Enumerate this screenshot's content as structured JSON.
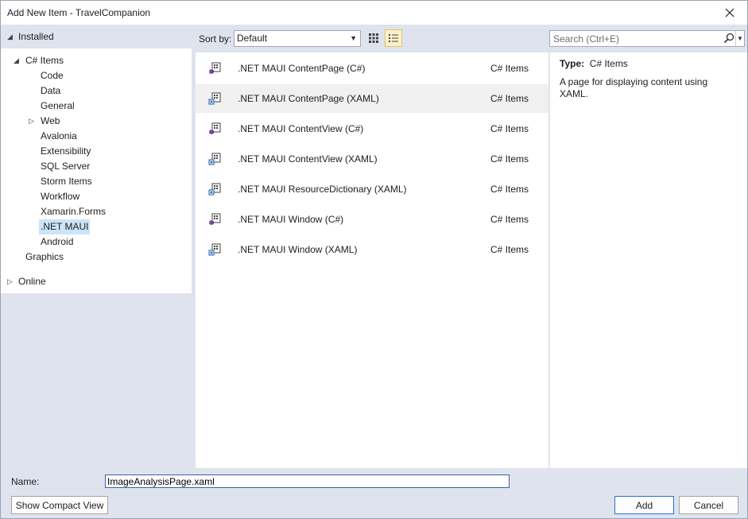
{
  "window": {
    "title": "Add New Item - TravelCompanion"
  },
  "left": {
    "installed": "Installed",
    "tree": {
      "root": "C# Items",
      "children": [
        "Code",
        "Data",
        "General",
        "Web",
        "Avalonia",
        "Extensibility",
        "SQL Server",
        "Storm Items",
        "Workflow",
        "Xamarin.Forms",
        ".NET MAUI",
        "Android"
      ],
      "graphics": "Graphics"
    },
    "selected": ".NET MAUI",
    "online": "Online"
  },
  "toolbar": {
    "sort_label": "Sort by:",
    "sort_value": "Default",
    "search_placeholder": "Search (Ctrl+E)"
  },
  "templates": [
    {
      "name": ".NET MAUI ContentPage (C#)",
      "category": "C# Items",
      "icon": "csharp-page-icon"
    },
    {
      "name": ".NET MAUI ContentPage (XAML)",
      "category": "C# Items",
      "icon": "xaml-page-icon"
    },
    {
      "name": ".NET MAUI ContentView (C#)",
      "category": "C# Items",
      "icon": "csharp-page-icon"
    },
    {
      "name": ".NET MAUI ContentView (XAML)",
      "category": "C# Items",
      "icon": "xaml-page-icon"
    },
    {
      "name": ".NET MAUI ResourceDictionary (XAML)",
      "category": "C# Items",
      "icon": "xaml-page-icon"
    },
    {
      "name": ".NET MAUI Window (C#)",
      "category": "C# Items",
      "icon": "csharp-page-icon"
    },
    {
      "name": ".NET MAUI Window (XAML)",
      "category": "C# Items",
      "icon": "xaml-page-icon"
    }
  ],
  "selected_template": ".NET MAUI ContentPage (XAML)",
  "details": {
    "type_label": "Type:",
    "type_value": "C# Items",
    "description": "A page for displaying content using XAML."
  },
  "footer": {
    "name_label": "Name:",
    "name_value": "ImageAnalysisPage.xaml",
    "compact_button": "Show Compact View",
    "add_button": "Add",
    "cancel_button": "Cancel"
  },
  "colors": {
    "background": "#dfe3ee",
    "selection_highlight": "#cce4f7",
    "active_view_button": "#fcf0c8",
    "primary_button_border": "#2a73cc"
  }
}
